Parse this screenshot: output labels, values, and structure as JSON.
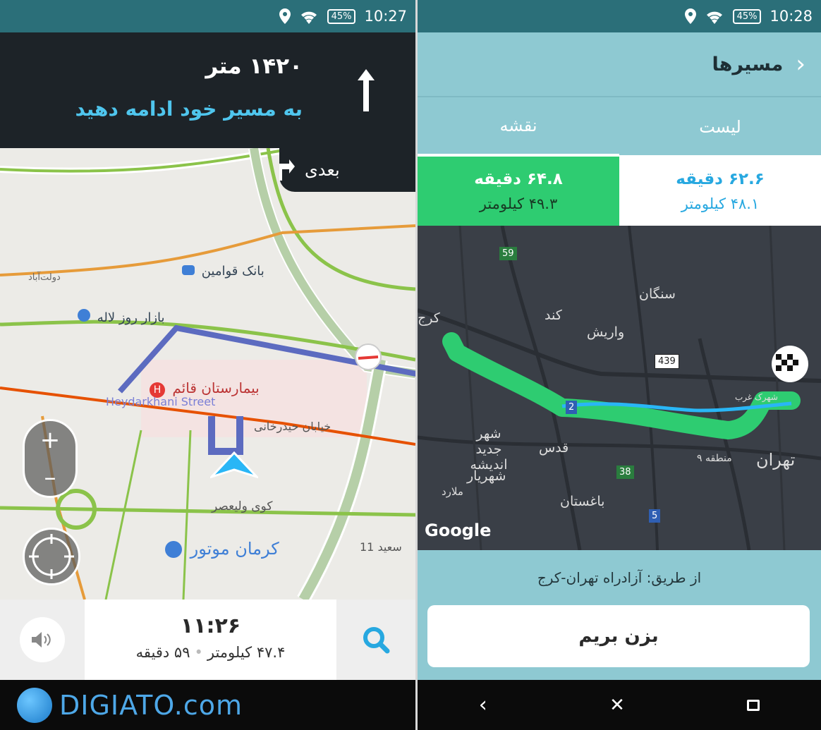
{
  "left_status": {
    "battery": "45%",
    "time": "10:27"
  },
  "right_status": {
    "battery": "45%",
    "time": "10:28"
  },
  "navigation": {
    "distance": "۱۴۲۰ متر",
    "instruction": "به مسیر خود ادامه دهید",
    "next_label": "بعدی"
  },
  "map_left_labels": {
    "bank": "بانک قوامین",
    "bazaar": "بازار روز لاله",
    "hospital": "بیمارستان قائم",
    "street_en": "Heydarkhani Street",
    "street_fa": "خیابان حیدرخانی",
    "alley": "کوی ولیعصر",
    "kerman": "کرمان موتور",
    "saeed": "سعید 11",
    "lane": "دولت‌آباد"
  },
  "map_controls": {
    "zoom_in": "+",
    "zoom_out": "–"
  },
  "trip": {
    "arrival": "۱۱:۲۶",
    "distance": "۴۷.۴ کیلومتر",
    "separator": "•",
    "duration": "۵۹ دقیقه"
  },
  "brand": {
    "text": "DIGIATO.com"
  },
  "routes": {
    "title": "مسیرها",
    "tabs": [
      {
        "label": "نقشه"
      },
      {
        "label": "لیست"
      }
    ],
    "selected": {
      "time": "۶۴.۸ دقیقه",
      "distance": "۴۹.۳ کیلومتر"
    },
    "alternative": {
      "time": "۶۲.۶ دقیقه",
      "distance": "۴۸.۱ کیلومتر"
    },
    "via": "از طریق: آزادراه تهران-کرج",
    "go_button": "بزن بریم"
  },
  "map_right": {
    "google": "Google",
    "labels": {
      "karaj": "کرج",
      "sangan": "سنگان",
      "kan": "کند",
      "vardij": "واریش",
      "shahr_jadid": "شهر جدید اندیشه",
      "qods": "قدس",
      "shahriar": "شهریار",
      "malard": "ملارد",
      "baghestan": "باغستان",
      "tehran": "تهران",
      "district": "منطقه ۹",
      "gharb": "شهرک غرب"
    },
    "roads": {
      "r59": "59",
      "r439": "439",
      "r2": "2",
      "r38": "38",
      "r5": "5"
    }
  },
  "colors": {
    "accent_green": "#2ecc71",
    "accent_blue": "#27a8e0",
    "header_dark": "#1d2328",
    "teal": "#8ec9d2"
  }
}
